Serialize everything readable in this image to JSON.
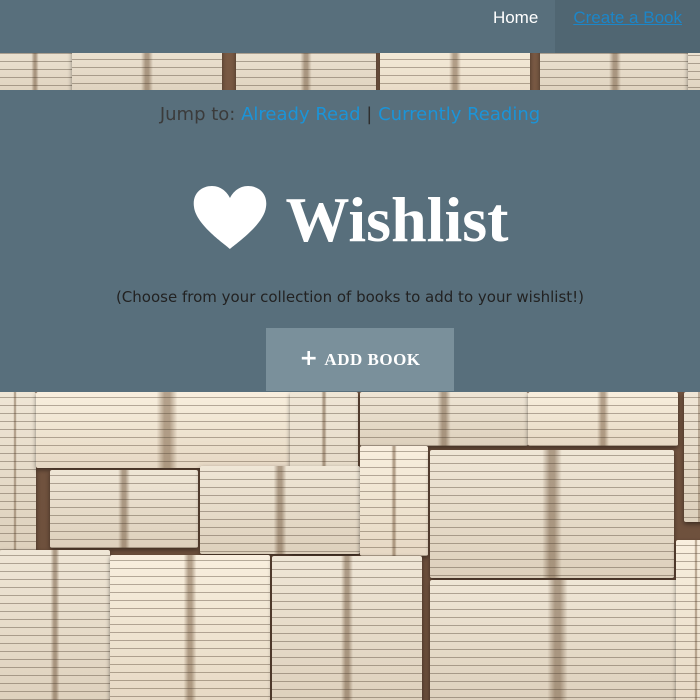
{
  "nav": {
    "home": "Home",
    "create": "Create a Book"
  },
  "jump": {
    "prefix": "Jump to:",
    "already_read": "Already Read",
    "separator": "|",
    "currently_reading": "Currently Reading"
  },
  "hero": {
    "icon": "heart-icon",
    "title": "Wishlist",
    "subtitle": "(Choose from your collection of books to add to your wishlist!)",
    "add_button_icon": "plus-icon",
    "add_button_label": "ADD BOOK"
  },
  "colors": {
    "panel": "#586f7c",
    "button": "#7a909b",
    "link": "#1b94d8",
    "title": "#ffffff"
  },
  "background": "open-books-photo"
}
